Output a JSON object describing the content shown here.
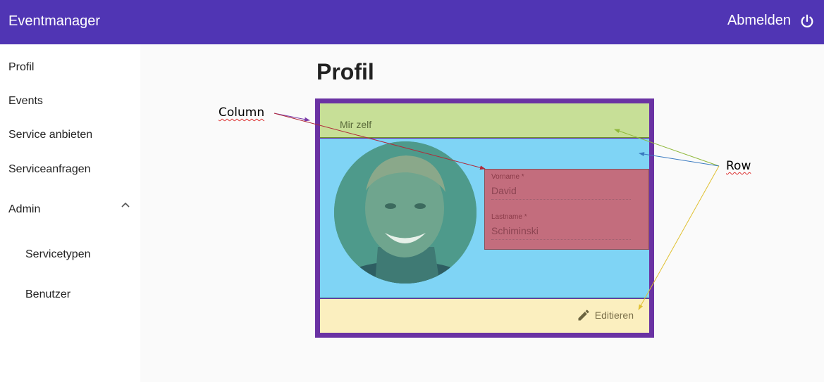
{
  "toolbar": {
    "title": "Eventmanager",
    "logout_label": "Abmelden",
    "logout_icon": "power-icon",
    "background": "#5035b4"
  },
  "sidenav": {
    "items": [
      {
        "label": "Profil"
      },
      {
        "label": "Events"
      },
      {
        "label": "Service anbieten"
      },
      {
        "label": "Serviceanfragen"
      },
      {
        "label": "Admin",
        "expanded": true,
        "icon": "chevron-up-icon"
      }
    ],
    "admin_subitems": [
      {
        "label": "Servicetypen"
      },
      {
        "label": "Benutzer"
      }
    ]
  },
  "main": {
    "page_title": "Profil",
    "card": {
      "header": "Mir zelf",
      "fields": [
        {
          "label": "Vorname *",
          "value": "David"
        },
        {
          "label": "Lastname *",
          "value": "Schiminski"
        }
      ],
      "edit_label": "Editieren",
      "edit_icon": "pencil-icon"
    }
  },
  "annotations": {
    "column_label": "Column",
    "row_label": "Row",
    "colors": {
      "card_border": "#6a32a3",
      "header_row": "#c7df97",
      "body_row": "#7fd4f5",
      "form_column": "#c36d7d",
      "footer_row": "#fbefbf"
    }
  }
}
